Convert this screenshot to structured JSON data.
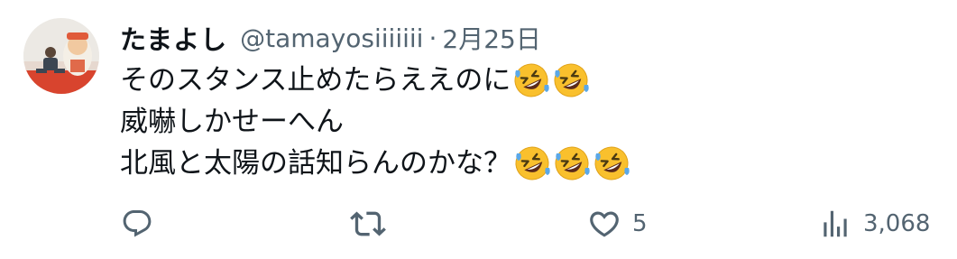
{
  "tweet": {
    "author": {
      "display_name": "たまよし",
      "handle": "@tamayosiiiiiii"
    },
    "separator": "·",
    "date": "2月25日",
    "lines": [
      "そのスタンス止めたらええのに",
      "威嚇しかせーへん",
      "北風と太陽の話知らんのかな？"
    ],
    "emoji": {
      "line1": [
        "rolling-on-floor-laughing",
        "rolling-on-floor-laughing"
      ],
      "line3": [
        "rolling-on-floor-laughing",
        "rolling-on-floor-laughing",
        "rolling-on-floor-laughing"
      ]
    },
    "actions": {
      "reply": {
        "icon": "reply-icon",
        "count": ""
      },
      "retweet": {
        "icon": "retweet-icon",
        "count": ""
      },
      "like": {
        "icon": "heart-icon",
        "count": "5"
      },
      "views": {
        "icon": "analytics-icon",
        "count": "3,068"
      }
    }
  },
  "colors": {
    "text_primary": "#0f1419",
    "text_secondary": "#536471",
    "background": "#ffffff",
    "emoji_face": "#f9c02d",
    "emoji_tears": "#5ba8e8"
  }
}
